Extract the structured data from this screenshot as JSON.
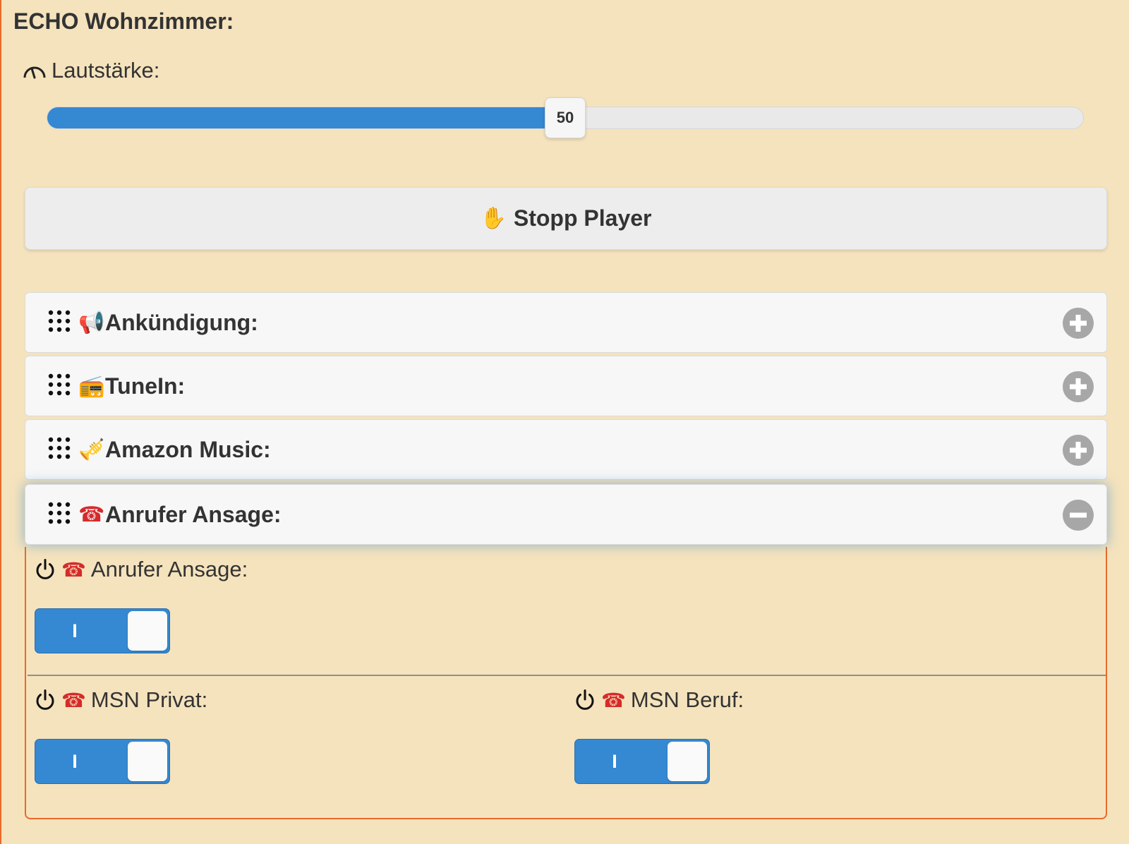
{
  "page": {
    "title": "ECHO Wohnzimmer:"
  },
  "volume": {
    "label": "Lautstärke:",
    "value": "50",
    "fraction": 0.5
  },
  "stop_button": {
    "icon": "✋",
    "label": "Stopp Player"
  },
  "accordion": [
    {
      "icon": "📢",
      "label": "Ankündigung:",
      "state": "collapsed"
    },
    {
      "icon": "📻",
      "label": "TuneIn:",
      "state": "collapsed"
    },
    {
      "icon": "🎺",
      "label": "Amazon Music:",
      "state": "collapsed"
    },
    {
      "icon": "☎",
      "label": "Anrufer Ansage:",
      "state": "expanded"
    }
  ],
  "panel": {
    "switches": [
      {
        "label": "Anrufer Ansage:",
        "icon": "☎",
        "state_mark": "I",
        "on": true
      },
      {
        "label": "MSN Privat:",
        "icon": "☎",
        "state_mark": "I",
        "on": true
      },
      {
        "label": "MSN Beruf:",
        "icon": "☎",
        "state_mark": "I",
        "on": true
      }
    ]
  },
  "colors": {
    "background": "#f5e3bd",
    "accent": "#3588d2",
    "panel_border": "#ea6a2b"
  }
}
